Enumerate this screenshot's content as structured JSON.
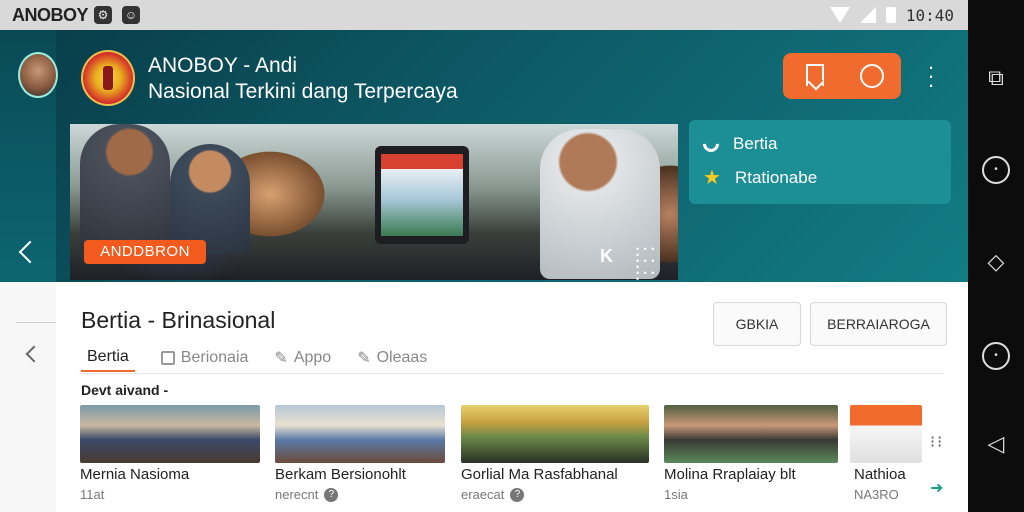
{
  "status_bar": {
    "app_name": "ANOBOY",
    "time": "10:40"
  },
  "header": {
    "title": "ANOBOY - Andi",
    "subtitle": "Nasional Terkini dang Terpercaya"
  },
  "hero": {
    "badge": "ANDDBRON",
    "k_label": "K"
  },
  "side_card": {
    "row1_label": "Bertia",
    "row2_label": "Rtationabe"
  },
  "section": {
    "title": "Bertia - Brinasional",
    "buttons": [
      "GBKIA",
      "BERRAIAROGA"
    ],
    "tabs": [
      "Bertia",
      "Berionaia",
      "Appo",
      "Oleaas"
    ],
    "sub_label": "Devt aivand -"
  },
  "news": [
    {
      "caption": "Mernia Nasioma",
      "meta": "11at"
    },
    {
      "caption": "Berkam Bersionohlt",
      "meta": "nerecnt"
    },
    {
      "caption": "Gorlial Ma Rasfabhanal",
      "meta": "eraecat"
    },
    {
      "caption": "Molina Rraplaiay blt",
      "meta": "1sia"
    },
    {
      "caption": "Nathioa",
      "meta": "NA3RO"
    }
  ],
  "icons": {
    "status": [
      "gear-icon",
      "emoji-icon",
      "wifi-icon",
      "signal-icon",
      "battery-icon"
    ],
    "nav": [
      "multiwindow-icon",
      "circle-icon",
      "home-outline-icon",
      "circle-icon",
      "back-triangle-icon"
    ]
  },
  "colors": {
    "accent": "#f26b2e",
    "teal": "#127c84",
    "card": "#1c8e96",
    "star": "#ffc81e"
  }
}
